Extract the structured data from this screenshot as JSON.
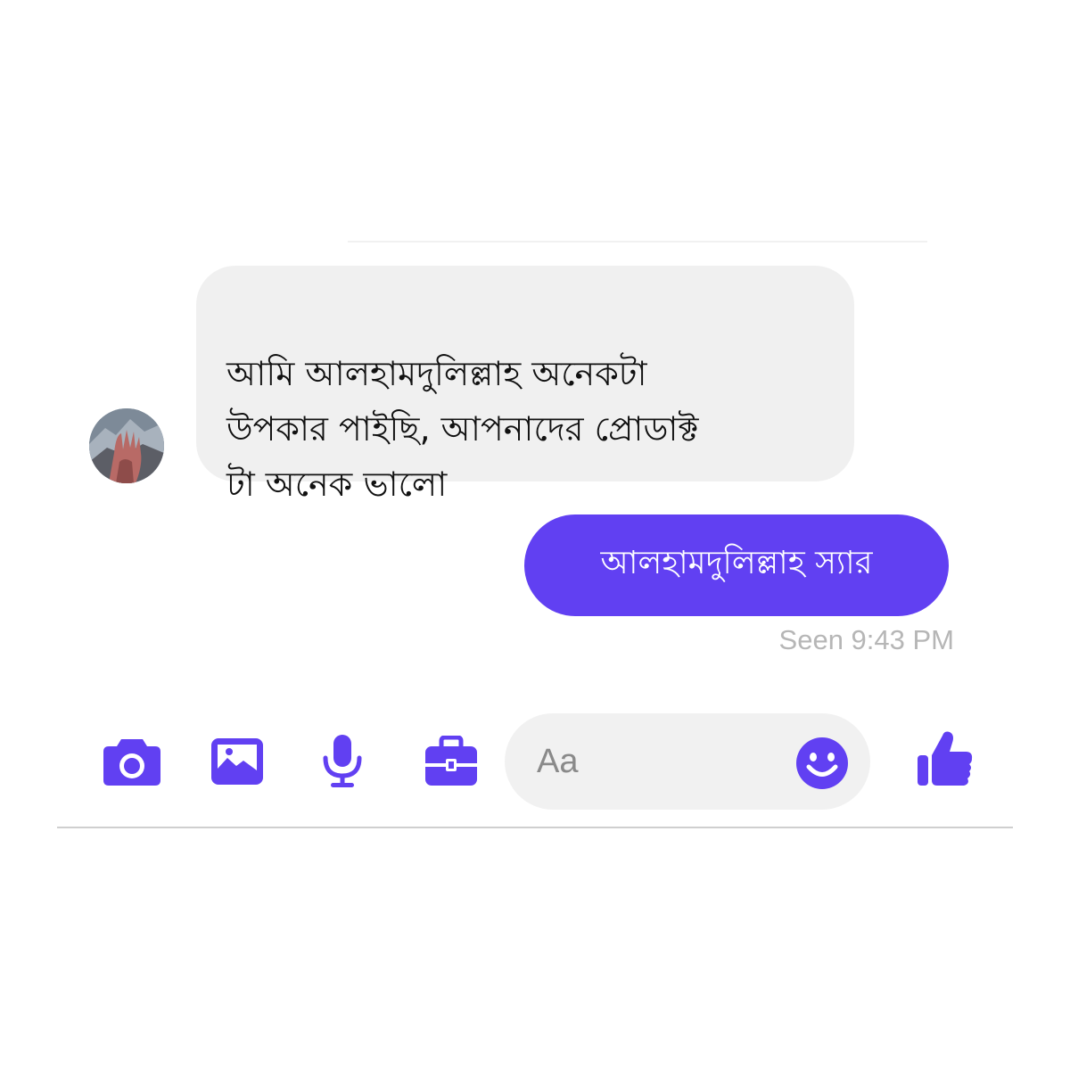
{
  "conversation": {
    "incoming_message": "আমি আলহামদুলিল্লাহ অনেকটা\nউপকার পাইছি, আপনাদের প্রোডাক্ট\nটা অনেক ভালো",
    "outgoing_message": "আলহামদুলিল্লাহ স্যার",
    "seen_status": "Seen 9:43 PM"
  },
  "composer": {
    "placeholder": "Aa",
    "icons": [
      "camera-icon",
      "image-icon",
      "microphone-icon",
      "toolbox-icon",
      "emoji-icon",
      "thumbs-up-icon"
    ]
  },
  "colors": {
    "accent": "#6140f2",
    "incoming_bubble": "#f0f0f0",
    "outgoing_text": "#ffffff",
    "status_text": "#b6b6b6",
    "input_background": "#f1f1f1"
  }
}
